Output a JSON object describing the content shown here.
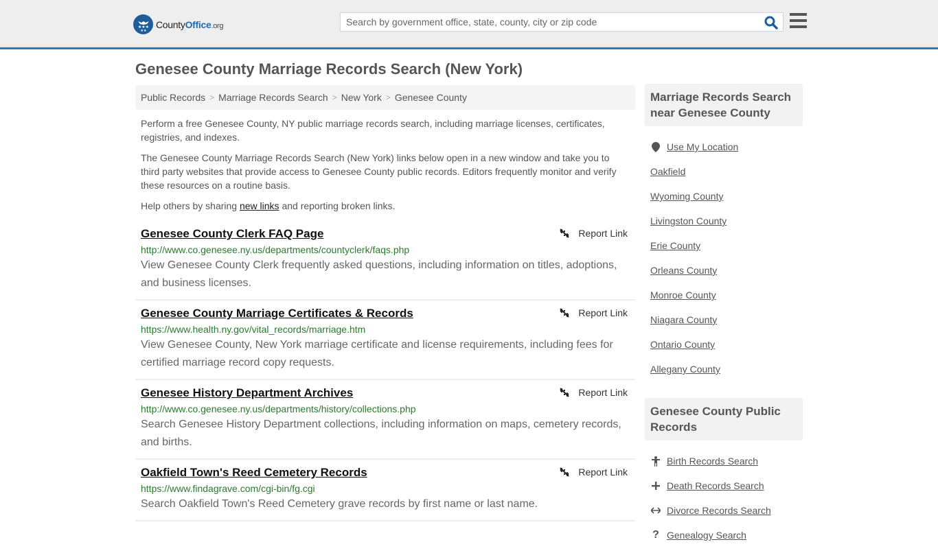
{
  "header": {
    "logo": {
      "word1": "County",
      "word2": "Office",
      "tld": ".org"
    },
    "search": {
      "placeholder": "Search by government office, state, county, city or zip code",
      "value": ""
    },
    "icons": {
      "search": "search-icon",
      "menu": "hamburger-menu-icon"
    }
  },
  "page_title": "Genesee County Marriage Records Search (New York)",
  "breadcrumb": [
    {
      "label": "Public Records"
    },
    {
      "label": "Marriage Records Search"
    },
    {
      "label": "New York"
    },
    {
      "label": "Genesee County"
    }
  ],
  "intro": {
    "p1": "Perform a free Genesee County, NY public marriage records search, including marriage licenses, certificates, registries, and indexes.",
    "p2": "The Genesee County Marriage Records Search (New York) links below open in a new window and take you to third party websites that provide access to Genesee County public records. Editors frequently monitor and verify these resources on a routine basis.",
    "p3_before": "Help others by sharing ",
    "p3_link": "new links",
    "p3_after": " and reporting broken links."
  },
  "report_label": "Report Link",
  "results": [
    {
      "title": "Genesee County Clerk FAQ Page",
      "url": "http://www.co.genesee.ny.us/departments/countyclerk/faqs.php",
      "description": "View Genesee County Clerk frequently asked questions, including information on titles, adoptions, and business licenses."
    },
    {
      "title": "Genesee County Marriage Certificates & Records",
      "url": "https://www.health.ny.gov/vital_records/marriage.htm",
      "description": "View Genesee County, New York marriage certificate and license requirements, including fees for certified marriage record copy requests."
    },
    {
      "title": "Genesee History Department Archives",
      "url": "http://www.co.genesee.ny.us/departments/history/collections.php",
      "description": "Search Genesee History Department collections, including information on maps, cemetery records, and births."
    },
    {
      "title": "Oakfield Town's Reed Cemetery Records",
      "url": "https://www.findagrave.com/cgi-bin/fg.cgi",
      "description": "Search Oakfield Town's Reed Cemetery grave records by first name or last name."
    }
  ],
  "sidebar": {
    "nearby": {
      "heading": "Marriage Records Search near Genesee County",
      "use_location": "Use My Location",
      "items": [
        "Oakfield",
        "Wyoming County",
        "Livingston County",
        "Erie County",
        "Orleans County",
        "Monroe County",
        "Niagara County",
        "Ontario County",
        "Allegany County"
      ]
    },
    "public_records": {
      "heading": "Genesee County Public Records",
      "items": [
        {
          "label": "Birth Records Search",
          "icon": "child-icon"
        },
        {
          "label": "Death Records Search",
          "icon": "cross-icon"
        },
        {
          "label": "Divorce Records Search",
          "icon": "left-right-arrow-icon"
        },
        {
          "label": "Genealogy Search",
          "icon": "question-icon"
        }
      ]
    }
  },
  "colors": {
    "brand_blue": "#1f5d99",
    "header_border": "#2f78b0",
    "url_green": "#2b7a2f"
  }
}
